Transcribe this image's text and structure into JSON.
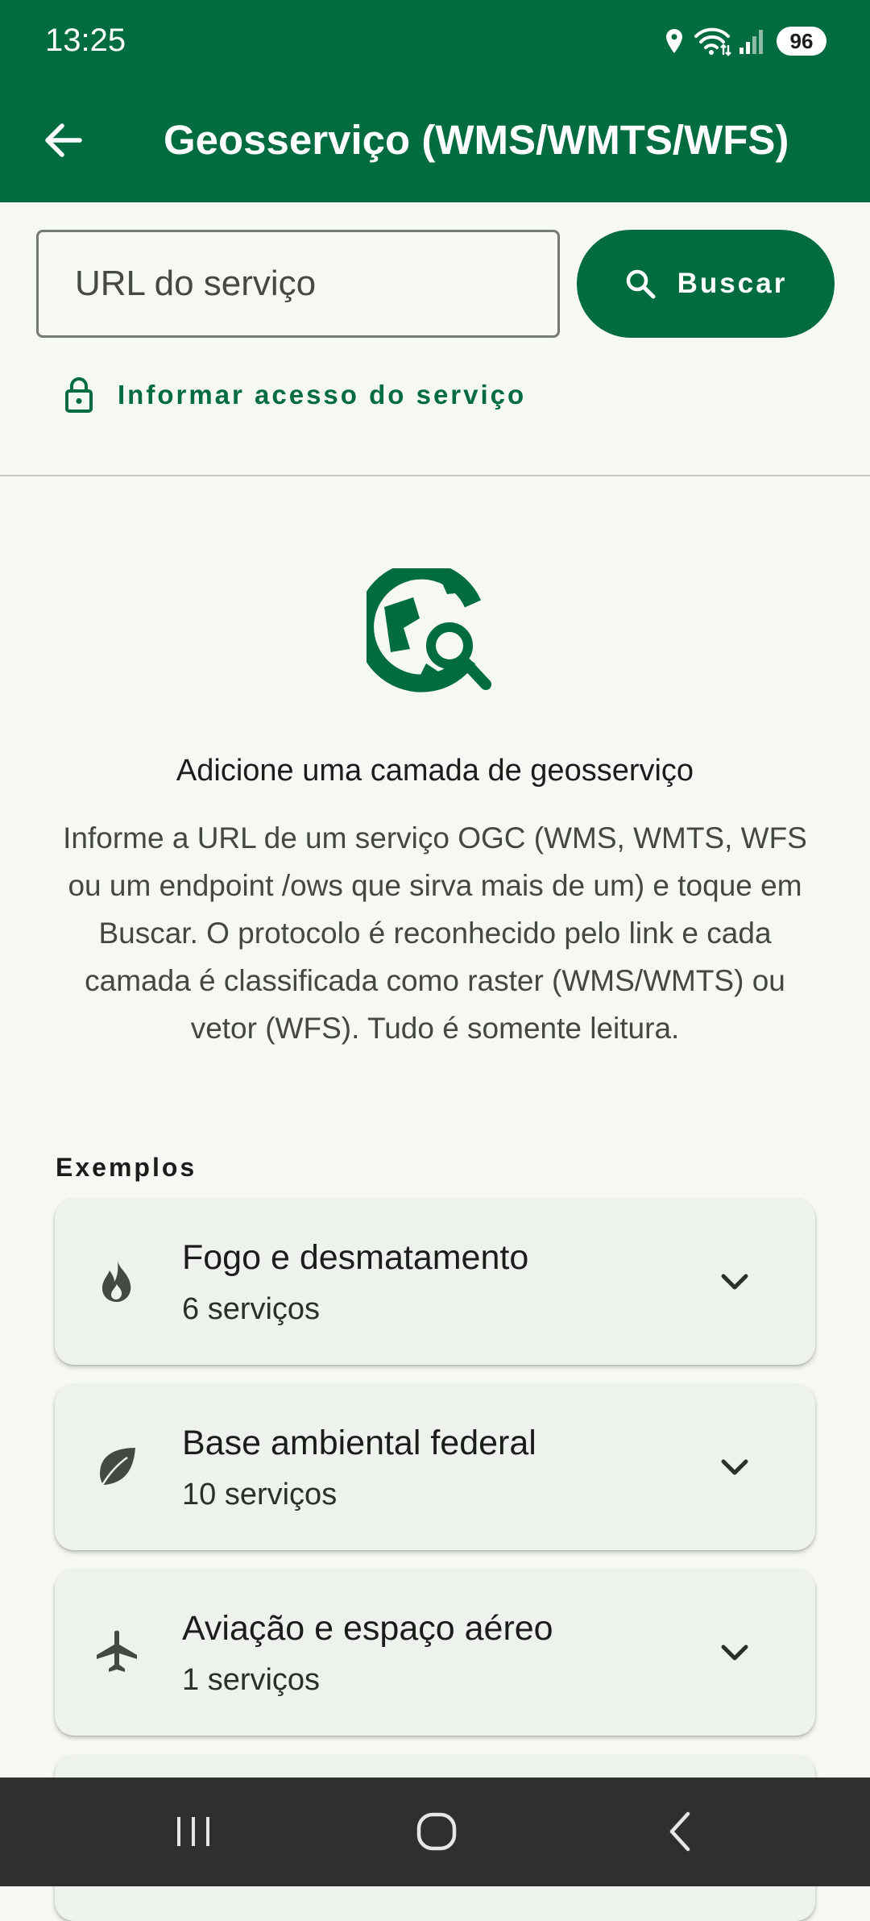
{
  "status_bar": {
    "time": "13:25",
    "battery": "96"
  },
  "header": {
    "title": "Geosserviço (WMS/WMTS/WFS)"
  },
  "search": {
    "placeholder": "URL do serviço",
    "value": "",
    "button_label": "Buscar"
  },
  "access_link": "Informar acesso do serviço",
  "empty_state": {
    "title": "Adicione uma camada de geosserviço",
    "description": "Informe a URL de um serviço OGC (WMS, WMTS, WFS ou um endpoint /ows que sirva mais de um) e toque em Buscar. O protocolo é reconhecido pelo link e cada camada é classificada como raster (WMS/WMTS) ou vetor (WFS). Tudo é somente leitura."
  },
  "examples": {
    "label": "Exemplos",
    "categories": [
      {
        "title": "Fogo e desmatamento",
        "subtitle": "6 serviços",
        "icon": "fire-icon"
      },
      {
        "title": "Base ambiental federal",
        "subtitle": "10 serviços",
        "icon": "leaf-icon"
      },
      {
        "title": "Aviação e espaço aéreo",
        "subtitle": "1 serviços",
        "icon": "airplane-icon"
      }
    ]
  },
  "colors": {
    "primary": "#006c3f",
    "background": "#f6f8f3",
    "card": "#eef2ec",
    "nav_bar": "#2f2f2f"
  },
  "nav_bar": {
    "icons": [
      "recents-icon",
      "home-icon",
      "back-nav-icon"
    ]
  }
}
